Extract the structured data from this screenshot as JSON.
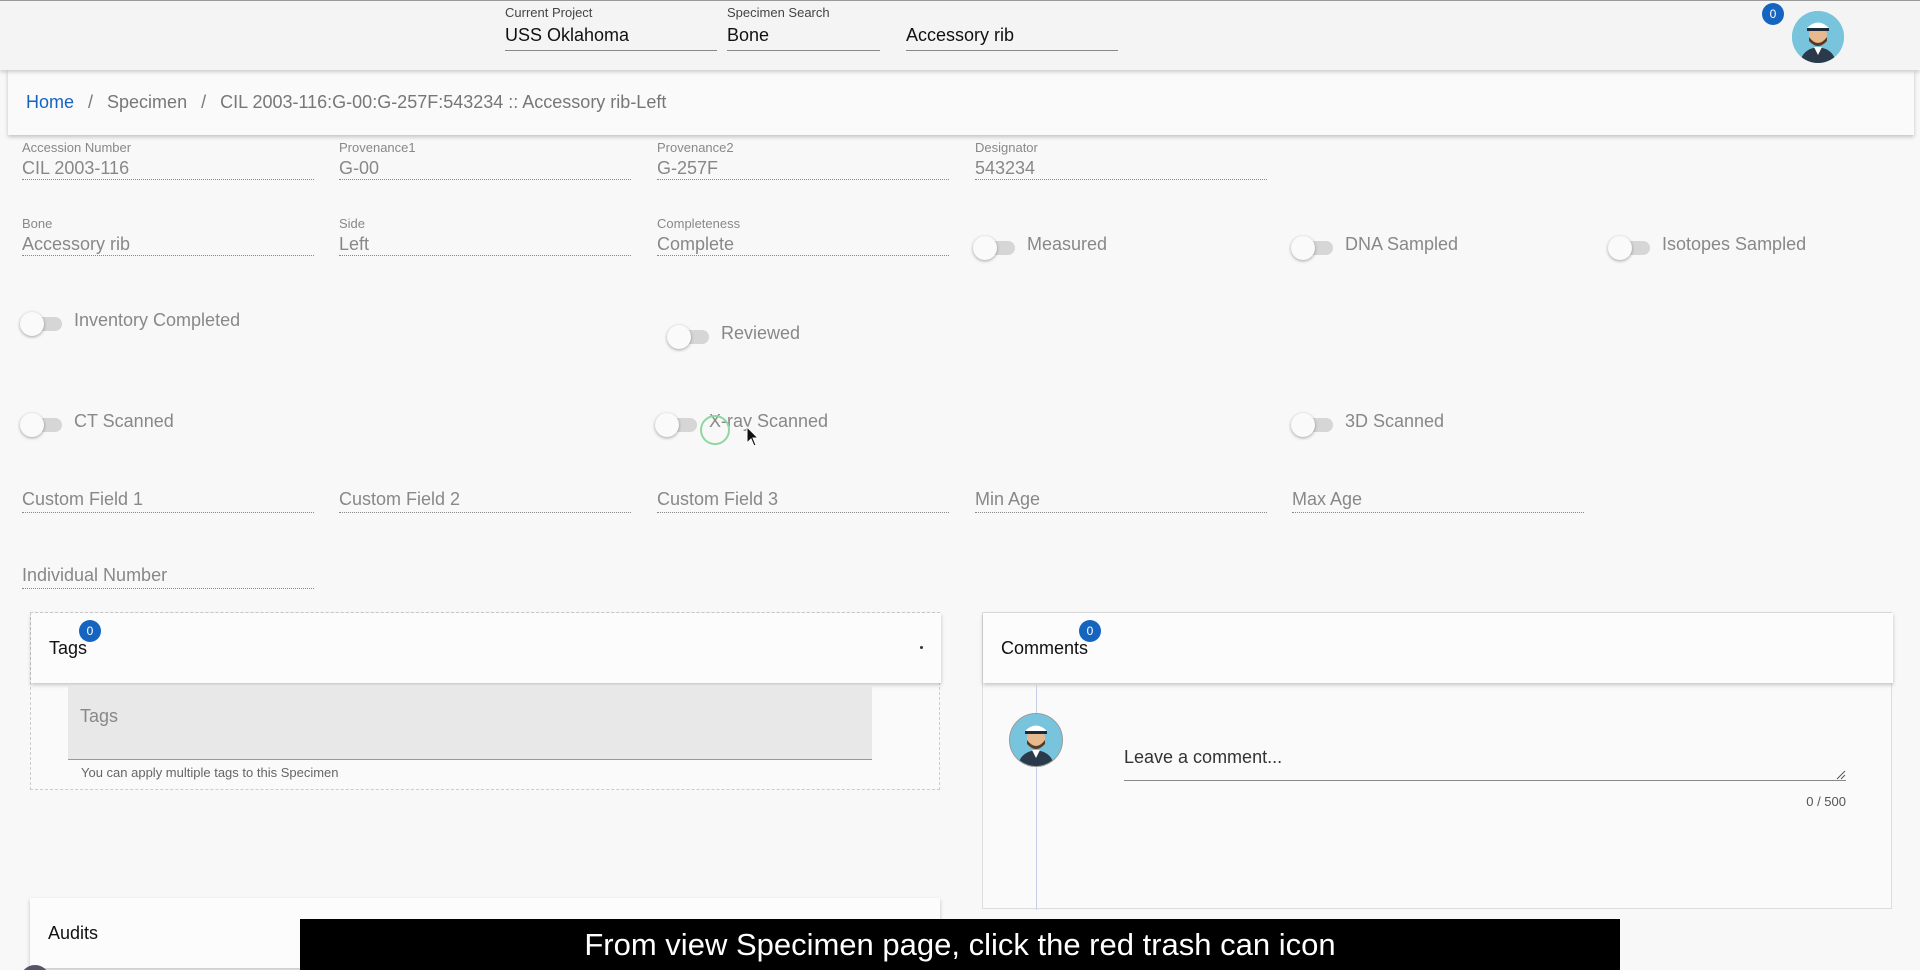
{
  "header": {
    "project_label": "Current Project",
    "project_value": "USS Oklahoma",
    "search_label": "Specimen Search",
    "search_value": "Bone",
    "bone_value": "Accessory rib",
    "notification_count": "0"
  },
  "breadcrumb": {
    "home": "Home",
    "sep1": "/",
    "specimen": "Specimen",
    "sep2": "/",
    "current": "CIL 2003-116:G-00:G-257F:543234 :: Accessory rib-Left"
  },
  "fields": {
    "accession_label": "Accession Number",
    "accession_value": "CIL 2003-116",
    "prov1_label": "Provenance1",
    "prov1_value": "G-00",
    "prov2_label": "Provenance2",
    "prov2_value": "G-257F",
    "designator_label": "Designator",
    "designator_value": "543234",
    "bone_label": "Bone",
    "bone_value": "Accessory rib",
    "side_label": "Side",
    "side_value": "Left",
    "completeness_label": "Completeness",
    "completeness_value": "Complete"
  },
  "toggles": {
    "measured": "Measured",
    "dna": "DNA Sampled",
    "isotopes": "Isotopes Sampled",
    "inventory": "Inventory Completed",
    "reviewed": "Reviewed",
    "ct": "CT Scanned",
    "xray": "X-ray Scanned",
    "scan3d": "3D Scanned"
  },
  "extra_fields": {
    "custom1": "Custom Field 1",
    "custom2": "Custom Field 2",
    "custom3": "Custom Field 3",
    "min_age": "Min Age",
    "max_age": "Max Age",
    "individual": "Individual Number"
  },
  "tags": {
    "title": "Tags",
    "count": "0",
    "placeholder": "Tags",
    "hint": "You can apply multiple tags to this Specimen"
  },
  "comments": {
    "title": "Comments",
    "count": "0",
    "placeholder": "Leave a comment...",
    "char_count": "0 / 500"
  },
  "audits": {
    "title": "Audits"
  },
  "caption": "From view Specimen page, click the red trash can icon"
}
